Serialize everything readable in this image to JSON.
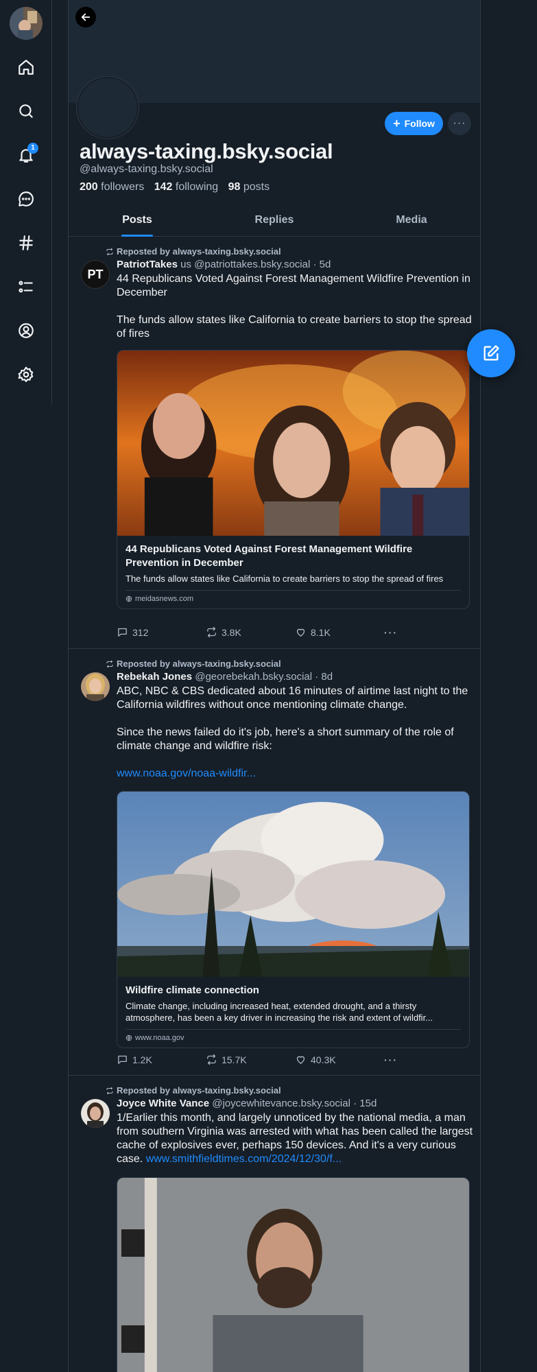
{
  "nav": {
    "items": [
      "home",
      "search",
      "notifications",
      "chat",
      "feeds",
      "lists",
      "profile",
      "settings"
    ],
    "notification_count": "1"
  },
  "profile": {
    "display_name": "always-taxing.bsky.social",
    "handle": "@always-taxing.bsky.social",
    "followers_count": "200",
    "followers_label": "followers",
    "following_count": "142",
    "following_label": "following",
    "posts_count": "98",
    "posts_label": "posts",
    "follow_label": "Follow",
    "more_label": "···"
  },
  "tabs": [
    {
      "label": "Posts",
      "active": true
    },
    {
      "label": "Replies",
      "active": false
    },
    {
      "label": "Media",
      "active": false
    }
  ],
  "posts": [
    {
      "repost_label": "Reposted by always-taxing.bsky.social",
      "author": "PatriotTakes",
      "author_suffix": " us",
      "meta": " @patriottakes.bsky.social · 5d",
      "avatar_text": "PT",
      "text": "44 Republicans Voted Against Forest Management Wildfire Prevention in December\n\nThe funds allow states like California to create barriers to stop the spread of fires",
      "embed": {
        "title": "44 Republicans Voted Against Forest Management Wildfire Prevention in December",
        "description": "The funds allow states like California to create barriers to stop the spread of fires",
        "domain": "meidasnews.com"
      },
      "replies": "312",
      "reposts": "3.8K",
      "likes": "8.1K"
    },
    {
      "repost_label": "Reposted by always-taxing.bsky.social",
      "author": "Rebekah Jones",
      "author_suffix": "",
      "meta": " @georebekah.bsky.social · 8d",
      "text": "ABC, NBC & CBS dedicated about 16 minutes of airtime last night to the California wildfires without once mentioning climate change.\n\nSince the news failed do it's job, here's a short summary of the role of climate change and wildfire risk:\n\n",
      "link": "www.noaa.gov/noaa-wildfir...",
      "embed": {
        "title": "Wildfire climate connection",
        "description": "Climate change, including increased heat, extended drought, and a thirsty atmosphere, has been a key driver in increasing the risk and extent of wildfir...",
        "domain": "www.noaa.gov"
      },
      "replies": "1.2K",
      "reposts": "15.7K",
      "likes": "40.3K"
    },
    {
      "repost_label": "Reposted by always-taxing.bsky.social",
      "author": "Joyce White Vance",
      "author_suffix": "",
      "meta": " @joycewhitevance.bsky.social · 15d",
      "text": "1/Earlier this month, and largely unnoticed by the national media, a man from southern Virginia was arrested with what has been called the largest cache of explosives ever, perhaps 150 devices. And it's a very curious case. ",
      "link": "www.smithfieldtimes.com/2024/12/30/f..."
    }
  ],
  "colors": {
    "background": "#161e27",
    "accent": "#208bfe",
    "muted_text": "#aebbc9",
    "border": "#2e3a48"
  }
}
